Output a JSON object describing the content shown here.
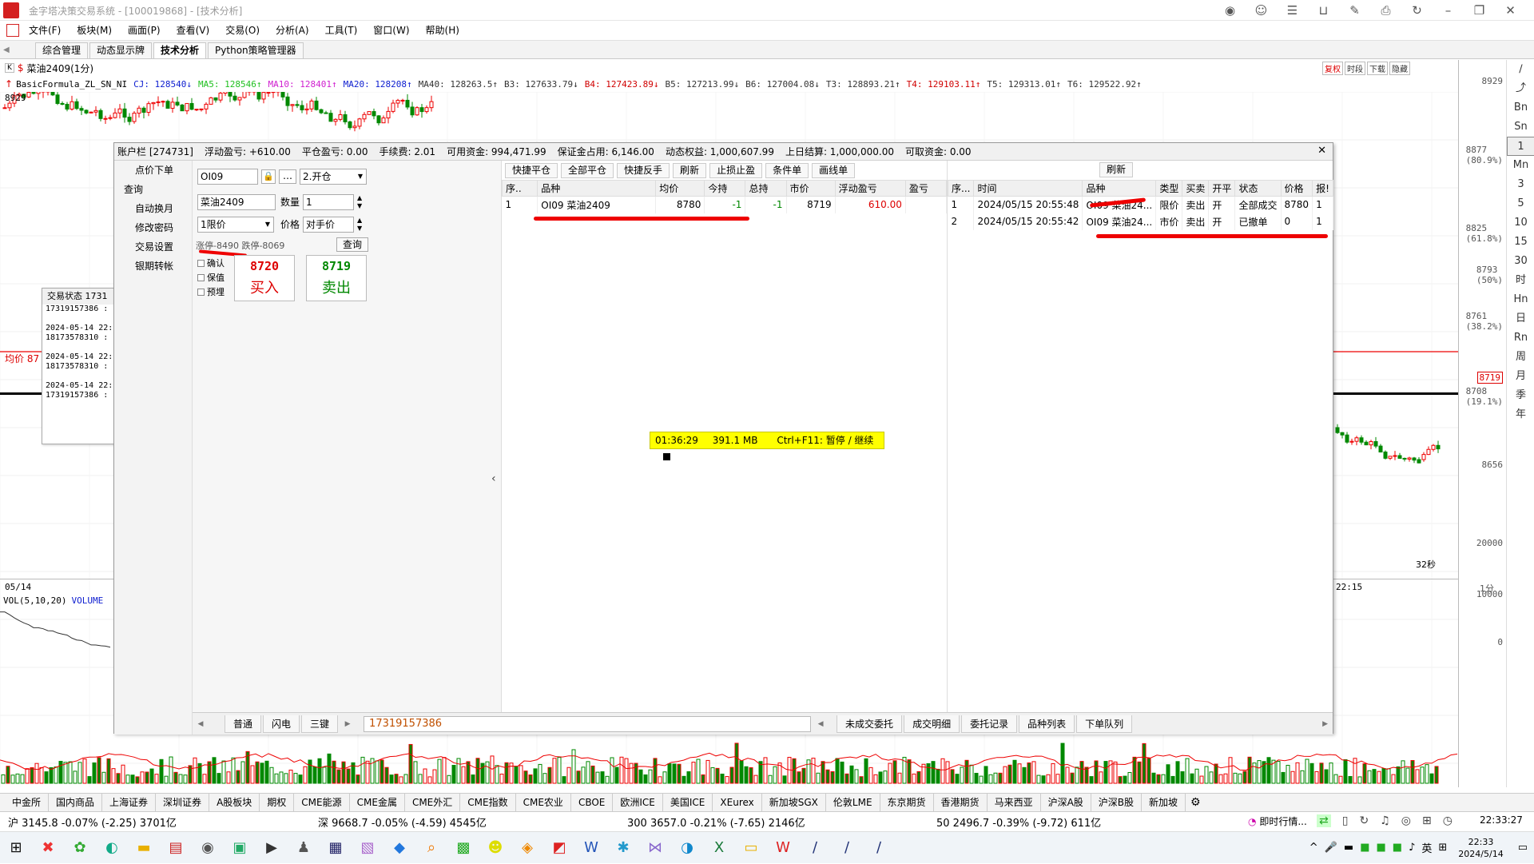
{
  "window": {
    "title": "金字塔决策交易系统 - [100019868] - [技术分析]"
  },
  "menu": [
    "文件(F)",
    "板块(M)",
    "画面(P)",
    "查看(V)",
    "交易(O)",
    "分析(A)",
    "工具(T)",
    "窗口(W)",
    "帮助(H)"
  ],
  "tabs": [
    "综合管理",
    "动态显示牌",
    "技术分析",
    "Python策略管理器"
  ],
  "chart": {
    "symbol": "菜油2409(1分)",
    "formula": "BasicFormula_ZL_SN_NI",
    "indicators": [
      {
        "text": "CJ: 128540↓",
        "color": "#1020d0"
      },
      {
        "text": "MA5: 128546↑",
        "color": "#20c020"
      },
      {
        "text": "MA10: 128401↑",
        "color": "#d020d0"
      },
      {
        "text": "MA20: 128208↑",
        "color": "#1020d0"
      },
      {
        "text": "MA40: 128263.5↑",
        "color": "#333333"
      },
      {
        "text": "B3: 127633.79↓",
        "color": "#333333"
      },
      {
        "text": "B4: 127423.89↓",
        "color": "#d00000"
      },
      {
        "text": "B5: 127213.99↓",
        "color": "#333333"
      },
      {
        "text": "B6: 127004.08↓",
        "color": "#333333"
      },
      {
        "text": "T3: 128893.21↑",
        "color": "#333333"
      },
      {
        "text": "T4: 129103.11↑",
        "color": "#d00000"
      },
      {
        "text": "T5: 129313.01↑",
        "color": "#333333"
      },
      {
        "text": "T6: 129522.92↑",
        "color": "#333333"
      }
    ],
    "top_left_price": "8929",
    "avg_label": "均价 87",
    "date_label": "05/14",
    "time_label": "22:15",
    "seconds_label": "32秒",
    "period_label": "1分",
    "vol_label": "VOL(5,10,20)",
    "vol_name": "VOLUME",
    "header_buttons": [
      "复权",
      "时段",
      "下载",
      "隐藏"
    ],
    "y_labels": [
      {
        "v": "8929"
      },
      {
        "v": "8877",
        "p": "(80.9%)"
      },
      {
        "v": "8825",
        "p": "(61.8%)"
      },
      {
        "v": "8793",
        "p": "(50%)"
      },
      {
        "v": "8761",
        "p": "(38.2%)"
      },
      {
        "v": "8719"
      },
      {
        "v": "8708",
        "p": "(19.1%)"
      },
      {
        "v": "8656"
      },
      {
        "v": "20000"
      },
      {
        "v": "10000"
      },
      {
        "v": "0"
      }
    ],
    "right_tools": [
      "Bn",
      "Sn",
      "1",
      "Mn",
      "3",
      "5",
      "10",
      "15",
      "30",
      "时",
      "Hn",
      "日",
      "Rn",
      "周",
      "月",
      "季",
      "年"
    ]
  },
  "trade": {
    "header": [
      "账户栏 [274731]",
      "浮动盈亏: +610.00",
      "平仓盈亏: 0.00",
      "手续费: 2.01",
      "可用资金: 994,471.99",
      "保证金占用: 6,146.00",
      "动态权益: 1,000,607.99",
      "上日结算: 1,000,000.00",
      "可取资金: 0.00"
    ],
    "left_menu": [
      "点价下单",
      "查询",
      "自动换月",
      "修改密码",
      "交易设置",
      "银期转帐"
    ],
    "form": {
      "code": "OI09",
      "open_mode": "2.开仓",
      "name": "菜油2409",
      "qty_label": "数量",
      "qty": "1",
      "order_type": "1限价",
      "price_label": "价格",
      "price": "对手价",
      "scribble": "涨停-8490 跌停-8069",
      "query_btn": "查询",
      "checkboxes": [
        "确认",
        "保值",
        "预埋"
      ],
      "buy_price": "8720",
      "buy_label": "买入",
      "sell_price": "8719",
      "sell_label": "卖出"
    },
    "pos_toolbar": [
      "快捷平仓",
      "全部平仓",
      "快捷反手",
      "刷新",
      "止损止盈",
      "条件单",
      "画线单"
    ],
    "pos_columns": [
      "序..",
      "品种",
      "均价",
      "今持",
      "总持",
      "市价",
      "浮动盈亏",
      "盈亏"
    ],
    "positions": [
      {
        "idx": "1",
        "name": "OI09 菜油2409",
        "avg": "8780",
        "today": "-1",
        "total": "-1",
        "market": "8719",
        "pnl": "610.00"
      }
    ],
    "ord_refresh": "刷新",
    "ord_columns": [
      "序...",
      "时间",
      "品种",
      "类型",
      "买卖",
      "开平",
      "状态",
      "价格",
      "报!"
    ],
    "orders": [
      {
        "idx": "1",
        "time": "2024/05/15 20:55:48",
        "name": "OI09 菜油24...",
        "type": "限价",
        "side": "卖出",
        "oc": "开",
        "status": "全部成交",
        "price": "8780",
        "qty": "1"
      },
      {
        "idx": "2",
        "time": "2024/05/15 20:55:42",
        "name": "OI09 菜油24...",
        "type": "市价",
        "side": "卖出",
        "oc": "开",
        "status": "已撤单",
        "price": "0",
        "qty": "1"
      }
    ],
    "bottom_left_tabs": [
      "普通",
      "闪电",
      "三键"
    ],
    "account_id": "17319157386",
    "bottom_right_tabs": [
      "未成交委托",
      "成交明细",
      "委托记录",
      "品种列表",
      "下单队列"
    ]
  },
  "status_window": {
    "title": "交易状态 1731",
    "entries": [
      "17319157386 :",
      "",
      "2024-05-14 22:",
      "18173578310 :",
      "",
      "2024-05-14 22:",
      "18173578310 :",
      "",
      "2024-05-14 22:",
      "17319157386 :"
    ]
  },
  "timer": {
    "time": "01:36:29",
    "mem": "391.1 MB",
    "hint": "Ctrl+F11: 暂停 / 继续"
  },
  "market_tabs": [
    "中金所",
    "国内商品",
    "上海证券",
    "深圳证券",
    "A股板块",
    "期权",
    "CME能源",
    "CME金属",
    "CME外汇",
    "CME指数",
    "CME农业",
    "CBOE",
    "欧洲ICE",
    "美国ICE",
    "XEurex",
    "新加坡SGX",
    "伦敦LME",
    "东京期货",
    "香港期货",
    "马来西亚",
    "沪深A股",
    "沪深B股",
    "新加坡"
  ],
  "index_bar": {
    "sh": "沪 3145.8 -0.07% (-2.25) 3701亿",
    "sz": "深 9668.7 -0.05% (-4.59) 4545亿",
    "s300": "300 3657.0 -0.21% (-7.65) 2146亿",
    "s50": "50 2496.7 -0.39% (-9.72) 611亿",
    "live": "即时行情...",
    "clock": "22:33:27"
  },
  "taskbar": {
    "time": "22:33",
    "date": "2024/5/14",
    "ime": "英"
  },
  "colors": {
    "up": "#e00000",
    "down": "#009000",
    "annotation": "#e00000"
  }
}
